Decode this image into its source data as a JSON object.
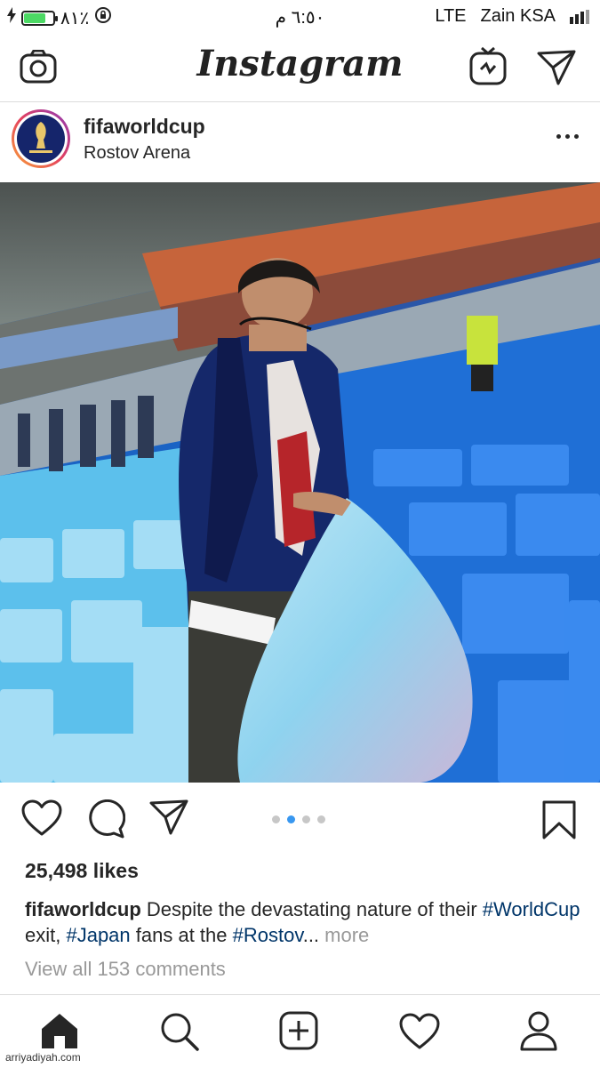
{
  "status_bar": {
    "battery_percent": "٨١٪",
    "battery_level": 0.81,
    "time": "٦:٥٠ م",
    "network": "LTE",
    "carrier": "Zain KSA"
  },
  "header": {
    "logo": "Instagram"
  },
  "post": {
    "username": "fifaworldcup",
    "location": "Rostov Arena",
    "image_alt_icon": "photo",
    "carousel": {
      "total": 4,
      "active_index": 1
    },
    "likes": "25,498 likes",
    "caption": {
      "user": "fifaworldcup",
      "text1": " Despite the devastating nature of their ",
      "tag1": "#WorldCup",
      "text2": " exit, ",
      "tag2": "#Japan",
      "text3": " fans at the ",
      "tag3": "#Rostov",
      "ellipsis": "...",
      "more": " more"
    },
    "comments": "View all 153 comments"
  },
  "watermark": "arriyadiyah.com",
  "colors": {
    "link": "#003569",
    "muted": "#999999",
    "active_dot": "#3897f0"
  }
}
